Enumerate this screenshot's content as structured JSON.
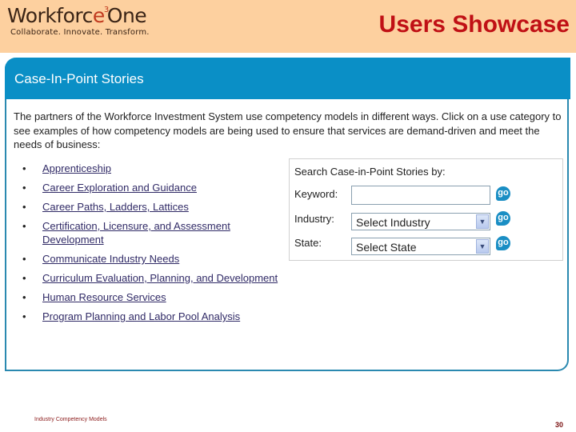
{
  "banner": {
    "logo_text_pre": "Workforc",
    "logo_text_e": "e",
    "logo_text_sup": "3",
    "logo_text_post": "One",
    "logo_tagline": "Collaborate.  Innovate.  Transform.",
    "slide_title": "Users Showcase"
  },
  "panel": {
    "title": "Case-In-Point Stories",
    "intro": "The partners of the Workforce Investment System use competency models in different ways. Click on a use category to see examples of how competency models are being used to ensure that services are demand-driven and meet the needs of business:",
    "categories": [
      {
        "label": "Apprenticeship"
      },
      {
        "label": "Career Exploration and Guidance"
      },
      {
        "label": "Career Paths, Ladders, Lattices"
      },
      {
        "label": "Certification, Licensure, and Assessment Development"
      },
      {
        "label": "Communicate Industry Needs"
      },
      {
        "label": "Curriculum Evaluation, Planning, and Development"
      },
      {
        "label": "Human Resource Services"
      },
      {
        "label": "Program Planning and Labor Pool Analysis"
      }
    ],
    "bullet": "•"
  },
  "search": {
    "title": "Search Case-in-Point Stories by:",
    "keyword_label": "Keyword:",
    "keyword_value": "",
    "industry_label": "Industry:",
    "industry_selected": "Select Industry",
    "state_label": "State:",
    "state_selected": "Select State",
    "go_label": "go",
    "dropdown_icon": "▼"
  },
  "footer": {
    "left_text": "Industry Competency Models",
    "page_number": "30"
  },
  "colors": {
    "banner_bg": "#fdd09f",
    "title_red": "#c01015",
    "panel_blue": "#0a8fc6",
    "link_color": "#302a66"
  }
}
